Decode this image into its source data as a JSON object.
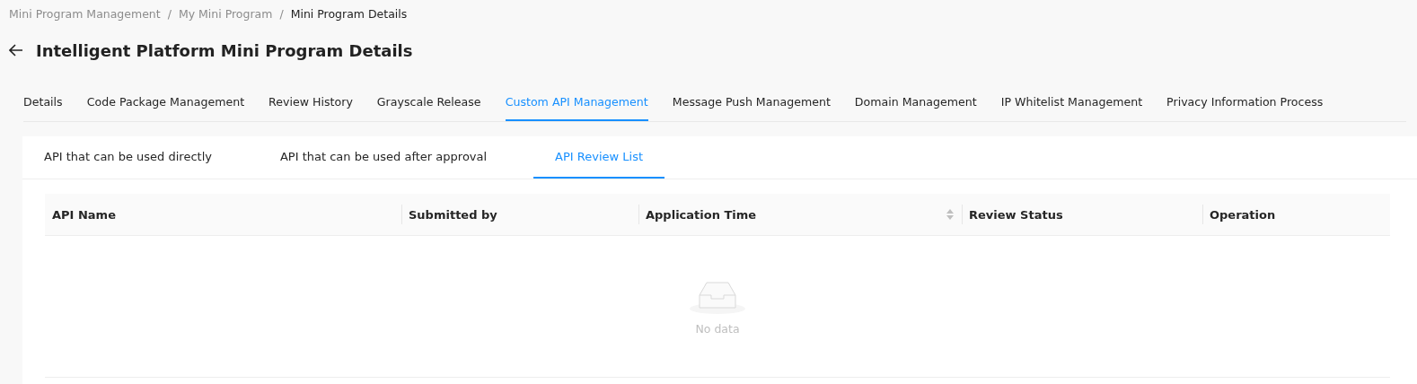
{
  "breadcrumb": [
    {
      "label": "Mini Program Management",
      "current": false
    },
    {
      "label": "My Mini Program",
      "current": false
    },
    {
      "label": "Mini Program Details",
      "current": true
    }
  ],
  "breadcrumb_separator": "/",
  "page_title": "Intelligent Platform Mini Program Details",
  "tabs": [
    {
      "label": "Details",
      "selected": false
    },
    {
      "label": "Code Package Management",
      "selected": false
    },
    {
      "label": "Review History",
      "selected": false
    },
    {
      "label": "Grayscale Release",
      "selected": false
    },
    {
      "label": "Custom API Management",
      "selected": true
    },
    {
      "label": "Message Push Management",
      "selected": false
    },
    {
      "label": "Domain Management",
      "selected": false
    },
    {
      "label": "IP Whitelist Management",
      "selected": false
    },
    {
      "label": "Privacy Information Process",
      "selected": false
    }
  ],
  "sub_tabs": [
    {
      "label": "API that can be used directly",
      "selected": false
    },
    {
      "label": "API that can be used after approval",
      "selected": false
    },
    {
      "label": "API Review List",
      "selected": true
    }
  ],
  "table": {
    "columns": [
      {
        "label": "API Name",
        "sortable": false
      },
      {
        "label": "Submitted by",
        "sortable": false
      },
      {
        "label": "Application Time",
        "sortable": true
      },
      {
        "label": "Review Status",
        "sortable": false
      },
      {
        "label": "Operation",
        "sortable": false
      }
    ],
    "empty_text": "No data"
  }
}
